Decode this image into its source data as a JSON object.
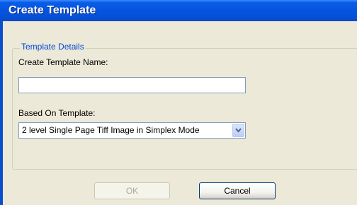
{
  "window": {
    "title": "Create Template"
  },
  "details": {
    "group_label": "Template Details",
    "name_label": "Create Template Name:",
    "name_value": "",
    "based_on_label": "Based On Template:",
    "based_on_value": "2 level Single Page Tiff Image in Simplex Mode"
  },
  "buttons": {
    "ok_label": "OK",
    "cancel_label": "Cancel"
  },
  "colors": {
    "titlebar": "#0656e0",
    "dialog_bg": "#ece9d8",
    "group_label": "#0046d5"
  }
}
